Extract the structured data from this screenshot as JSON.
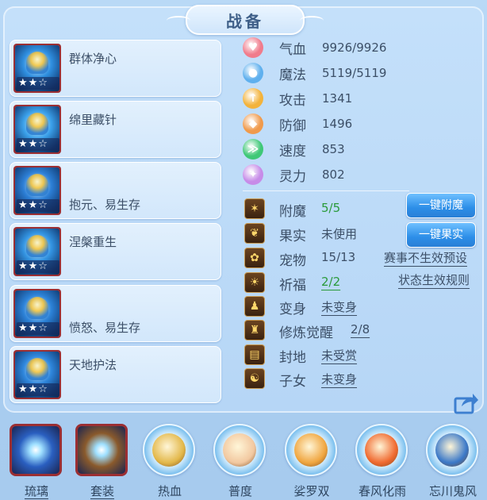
{
  "title": "战备",
  "cards": [
    {
      "name": "群体净心",
      "stars": "★★☆",
      "art": "#2f8fe0"
    },
    {
      "name": "绵里藏针",
      "stars": "★★☆",
      "art": "#3aa0ea"
    },
    {
      "name": "抱元、易生存",
      "stars": "★★☆",
      "art": "#2c7fd6"
    },
    {
      "name": "涅槃重生",
      "stars": "★★☆",
      "art": "#3394e2"
    },
    {
      "name": "愤怒、易生存",
      "stars": "★★☆",
      "art": "#2c82d8"
    },
    {
      "name": "天地护法",
      "stars": "★★☆",
      "art": "#2e86dc"
    }
  ],
  "stats": [
    {
      "label": "气血",
      "value": "9926/9926",
      "icon": "heart-icon",
      "color": "#f07c8c",
      "glyph": "♥"
    },
    {
      "label": "魔法",
      "value": "5119/5119",
      "icon": "mana-icon",
      "color": "#5fb0ee",
      "glyph": "●"
    },
    {
      "label": "攻击",
      "value": "1341",
      "icon": "sword-icon",
      "color": "#f3b33c",
      "glyph": "↑"
    },
    {
      "label": "防御",
      "value": "1496",
      "icon": "shield-icon",
      "color": "#f09a4c",
      "glyph": "◆"
    },
    {
      "label": "速度",
      "value": "853",
      "icon": "speed-icon",
      "color": "#3fc877",
      "glyph": "≫"
    },
    {
      "label": "灵力",
      "value": "802",
      "icon": "spirit-icon",
      "color": "#c78ce8",
      "glyph": "✦"
    }
  ],
  "extras": [
    {
      "label": "附魔",
      "value": "5/5",
      "icon": "enchant-icon",
      "glyph": "✶",
      "style": "green"
    },
    {
      "label": "果实",
      "value": "未使用",
      "icon": "fruit-icon",
      "glyph": "❦",
      "style": ""
    },
    {
      "label": "宠物",
      "value": "15/13",
      "icon": "pet-icon",
      "glyph": "✿",
      "style": ""
    },
    {
      "label": "祈福",
      "value": "2/2",
      "icon": "blessing-icon",
      "glyph": "☀",
      "style": "green u"
    },
    {
      "label": "变身",
      "value": "未变身",
      "icon": "transform-icon",
      "glyph": "♟",
      "style": "u"
    },
    {
      "label": "修炼觉醒",
      "value": "2/8",
      "icon": "cultivate-icon",
      "glyph": "♜",
      "style": "u u2"
    },
    {
      "label": "封地",
      "value": "未受赏",
      "icon": "fief-icon",
      "glyph": "▤",
      "style": "u"
    },
    {
      "label": "子女",
      "value": "未变身",
      "icon": "child-icon",
      "glyph": "☯",
      "style": "u"
    }
  ],
  "buttons": {
    "enchant": "一键附魔",
    "fruit": "一键果实"
  },
  "links": {
    "preview": "赛事不生效预设",
    "rules": "状态生效规则"
  },
  "tabs": [
    {
      "label": "琉璃",
      "icon": "glaze-icon",
      "kind": "sq",
      "color": "#2a5fc0",
      "underline": true
    },
    {
      "label": "套装",
      "icon": "suit-icon",
      "kind": "sq",
      "color": "#8a5a2c",
      "underline": true
    },
    {
      "label": "热血",
      "icon": "hot-blood-icon",
      "kind": "round",
      "color": "#e3b84a",
      "underline": false
    },
    {
      "label": "普度",
      "icon": "salvation-icon",
      "kind": "round",
      "color": "#f2c8a0",
      "underline": false
    },
    {
      "label": "娑罗双",
      "icon": "sala-icon",
      "kind": "round",
      "color": "#f0a640",
      "underline": false
    },
    {
      "label": "春风化雨",
      "icon": "spring-rain-icon",
      "kind": "round",
      "color": "#f06a30",
      "underline": false
    },
    {
      "label": "忘川鬼风",
      "icon": "ghost-wind-icon",
      "kind": "round",
      "color": "#3a78c8",
      "underline": false
    }
  ]
}
